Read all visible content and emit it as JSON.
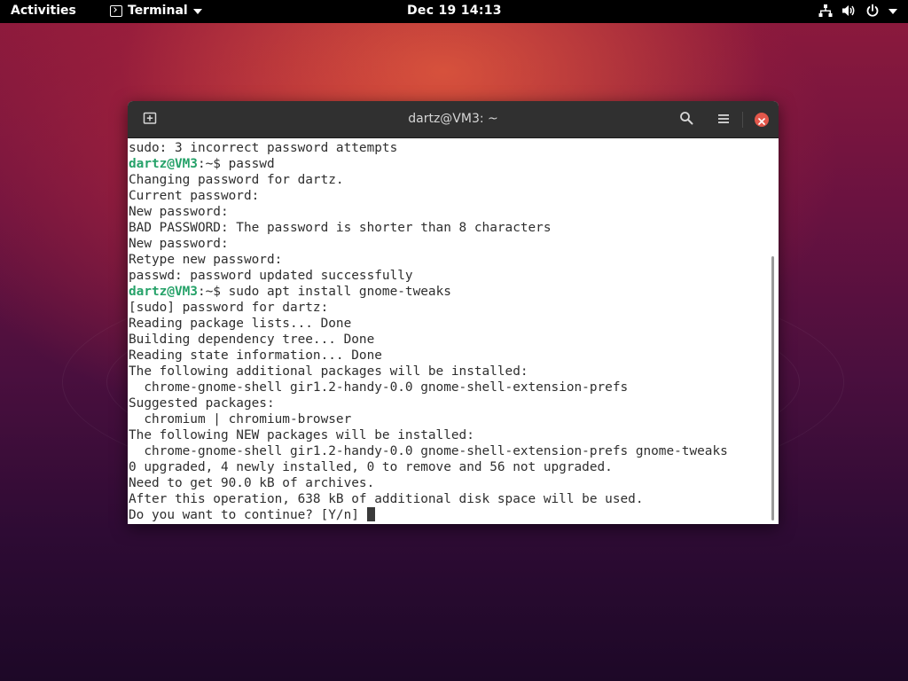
{
  "topbar": {
    "activities_label": "Activities",
    "app_menu_label": "Terminal",
    "clock": "Dec 19  14:13",
    "icons": [
      "network-icon",
      "volume-icon",
      "power-icon",
      "chevron-down-icon"
    ]
  },
  "window": {
    "title": "dartz@VM3: ~",
    "buttons": [
      "new-tab-icon",
      "search-icon",
      "hamburger-menu-icon",
      "close-icon"
    ]
  },
  "terminal": {
    "prompt": "dartz@VM3",
    "lines": [
      {
        "prompt": "",
        "text": "sudo: 3 incorrect password attempts"
      },
      {
        "prompt": "dartz@VM3",
        "text": ":~$ passwd"
      },
      {
        "prompt": "",
        "text": "Changing password for dartz."
      },
      {
        "prompt": "",
        "text": "Current password:"
      },
      {
        "prompt": "",
        "text": "New password:"
      },
      {
        "prompt": "",
        "text": "BAD PASSWORD: The password is shorter than 8 characters"
      },
      {
        "prompt": "",
        "text": "New password:"
      },
      {
        "prompt": "",
        "text": "Retype new password:"
      },
      {
        "prompt": "",
        "text": "passwd: password updated successfully"
      },
      {
        "prompt": "dartz@VM3",
        "text": ":~$ sudo apt install gnome-tweaks"
      },
      {
        "prompt": "",
        "text": "[sudo] password for dartz:"
      },
      {
        "prompt": "",
        "text": "Reading package lists... Done"
      },
      {
        "prompt": "",
        "text": "Building dependency tree... Done"
      },
      {
        "prompt": "",
        "text": "Reading state information... Done"
      },
      {
        "prompt": "",
        "text": "The following additional packages will be installed:"
      },
      {
        "prompt": "",
        "text": "  chrome-gnome-shell gir1.2-handy-0.0 gnome-shell-extension-prefs"
      },
      {
        "prompt": "",
        "text": "Suggested packages:"
      },
      {
        "prompt": "",
        "text": "  chromium | chromium-browser"
      },
      {
        "prompt": "",
        "text": "The following NEW packages will be installed:"
      },
      {
        "prompt": "",
        "text": "  chrome-gnome-shell gir1.2-handy-0.0 gnome-shell-extension-prefs gnome-tweaks"
      },
      {
        "prompt": "",
        "text": "0 upgraded, 4 newly installed, 0 to remove and 56 not upgraded."
      },
      {
        "prompt": "",
        "text": "Need to get 90.0 kB of archives."
      },
      {
        "prompt": "",
        "text": "After this operation, 638 kB of additional disk space will be used."
      },
      {
        "prompt": "",
        "text": "Do you want to continue? [Y/n] "
      }
    ]
  },
  "colors": {
    "prompt": "#26a269",
    "headerbar": "#303030",
    "close_button": "#e3574b",
    "topbar": "#000000"
  }
}
